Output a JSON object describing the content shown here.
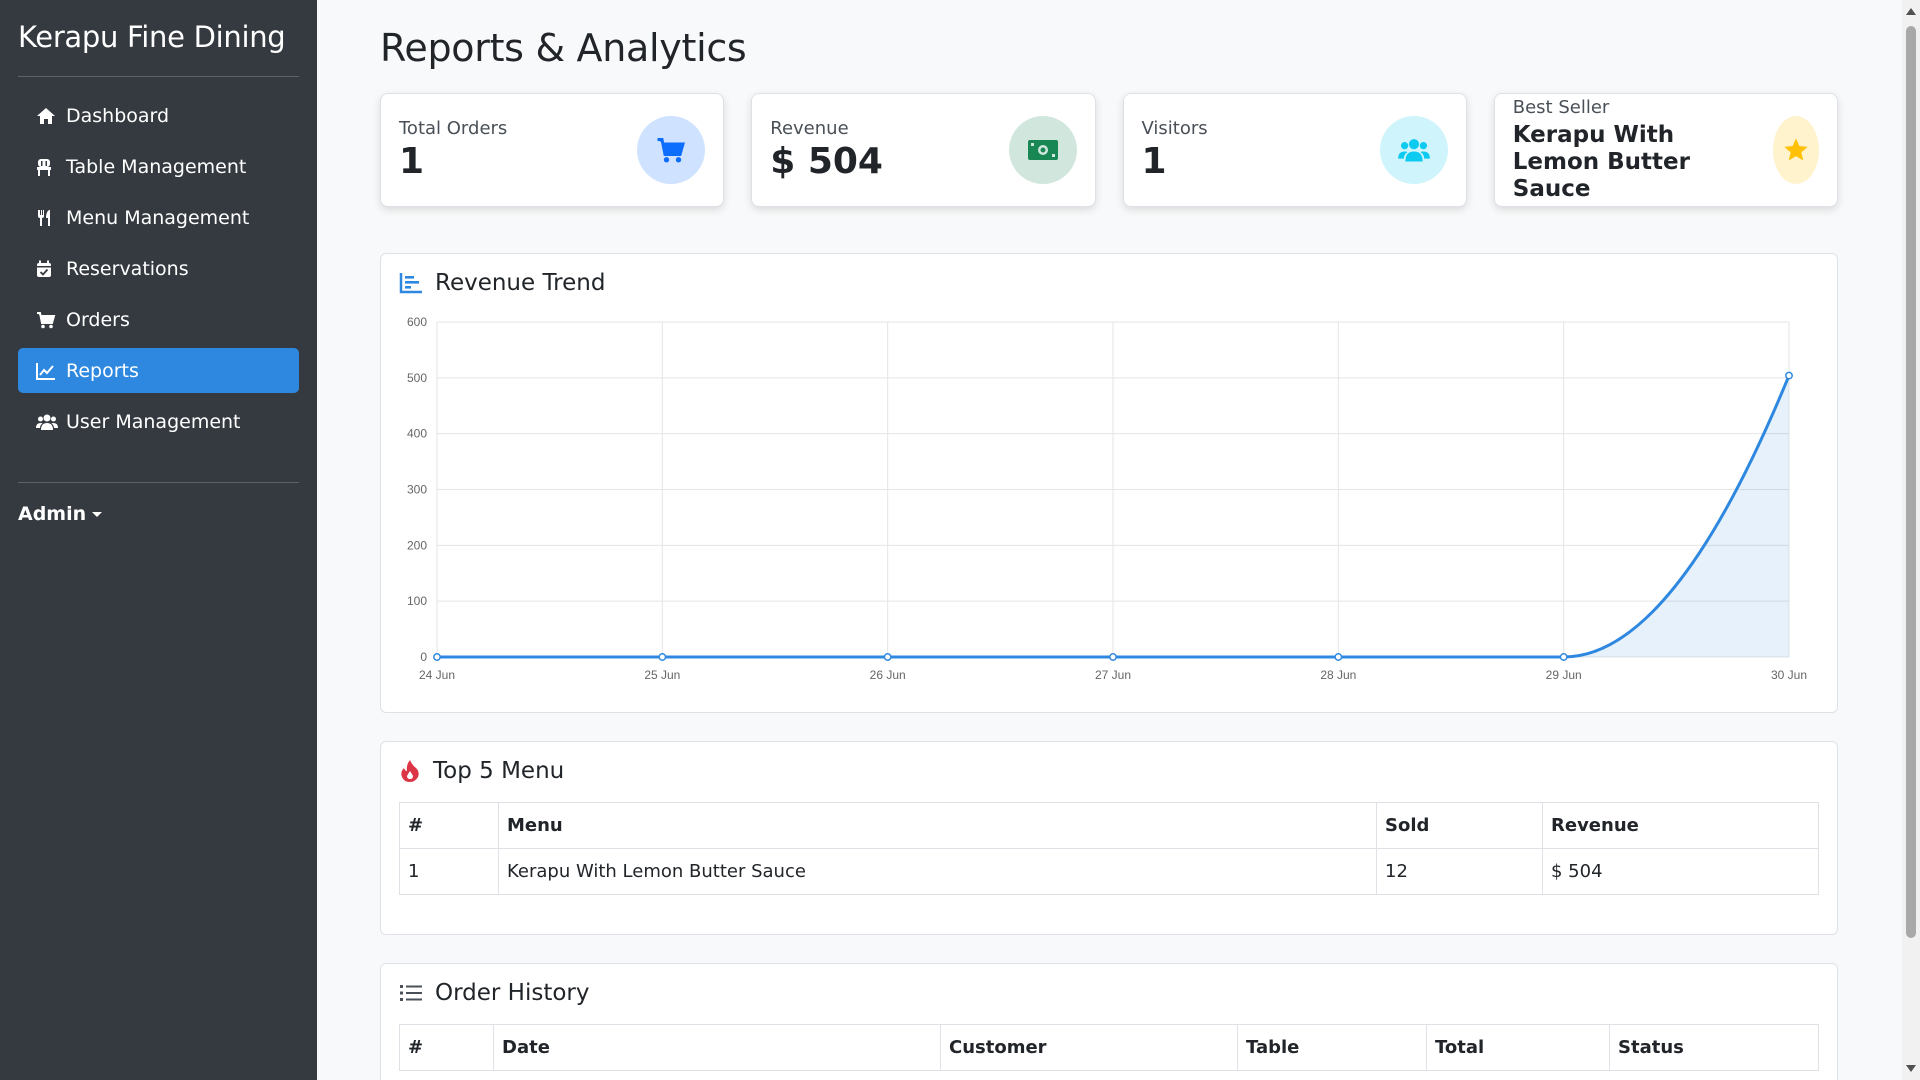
{
  "sidebar": {
    "brand": "Kerapu Fine Dining",
    "items": [
      {
        "label": "Dashboard",
        "icon": "home-icon"
      },
      {
        "label": "Table Management",
        "icon": "chair-icon"
      },
      {
        "label": "Menu Management",
        "icon": "utensils-icon"
      },
      {
        "label": "Reservations",
        "icon": "calendar-check-icon"
      },
      {
        "label": "Orders",
        "icon": "cart-icon"
      },
      {
        "label": "Reports",
        "icon": "chart-line-icon",
        "active": true
      },
      {
        "label": "User Management",
        "icon": "users-icon"
      }
    ],
    "user": "Admin"
  },
  "page": {
    "title": "Reports & Analytics"
  },
  "cards": {
    "orders": {
      "label": "Total Orders",
      "value": "1",
      "icon": "cart-icon",
      "color": "#0d6efd"
    },
    "revenue": {
      "label": "Revenue",
      "value": "$ 504",
      "icon": "money-bill-icon",
      "color": "#198754"
    },
    "visitors": {
      "label": "Visitors",
      "value": "1",
      "icon": "users-icon",
      "color": "#0dcaf0"
    },
    "best": {
      "label": "Best Seller",
      "value": "Kerapu With Lemon Butter Sauce",
      "icon": "star-icon",
      "color": "#ffc107"
    }
  },
  "revenue_panel": {
    "title": "Revenue Trend"
  },
  "chart_data": {
    "type": "area",
    "title": "Revenue Trend",
    "categories": [
      "24 Jun",
      "25 Jun",
      "26 Jun",
      "27 Jun",
      "28 Jun",
      "29 Jun",
      "30 Jun"
    ],
    "values": [
      0,
      0,
      0,
      0,
      0,
      0,
      504
    ],
    "ylim": [
      0,
      600
    ],
    "yticks": [
      0,
      100,
      200,
      300,
      400,
      500,
      600
    ],
    "grid": true,
    "color": "#2f88e0"
  },
  "top_menu": {
    "title": "Top 5 Menu",
    "headers": [
      "#",
      "Menu",
      "Sold",
      "Revenue"
    ],
    "rows": [
      [
        "1",
        "Kerapu With Lemon Butter Sauce",
        "12",
        "$ 504"
      ]
    ]
  },
  "order_history": {
    "title": "Order History",
    "headers": [
      "#",
      "Date",
      "Customer",
      "Table",
      "Total",
      "Status"
    ]
  }
}
